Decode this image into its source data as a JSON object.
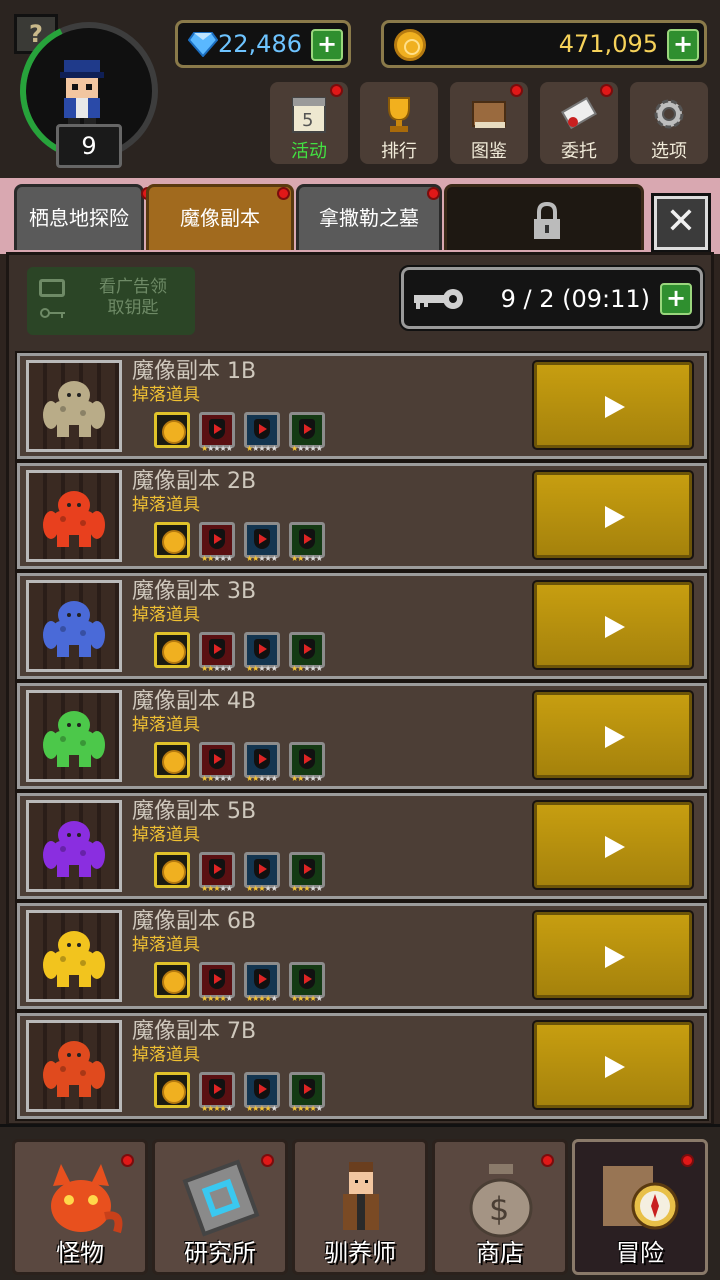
{
  "player": {
    "level": "9",
    "help_glyph": "?"
  },
  "currency": {
    "gems": "22,486",
    "gold": "471,095",
    "plus_glyph": "+"
  },
  "top_menu": [
    {
      "label": "活动",
      "icon": "calendar-icon",
      "active": true,
      "badge": true
    },
    {
      "label": "排行",
      "icon": "trophy-icon",
      "active": false,
      "badge": false
    },
    {
      "label": "图鉴",
      "icon": "book-icon",
      "active": false,
      "badge": true
    },
    {
      "label": "委托",
      "icon": "scroll-icon",
      "active": false,
      "badge": true
    },
    {
      "label": "选项",
      "icon": "gear-icon",
      "active": false,
      "badge": false
    }
  ],
  "tabs": [
    {
      "label": "栖息地探险",
      "badge": true
    },
    {
      "label": "魔像副本",
      "badge": true,
      "active": true
    },
    {
      "label": "拿撒勒之墓",
      "badge": true
    },
    {
      "label": "",
      "locked": true
    }
  ],
  "close_glyph": "✕",
  "ad_button": {
    "line1": "看广告领",
    "line2": "取钥匙"
  },
  "keys": {
    "value": "9 / 2 (09:11)"
  },
  "dungeons": [
    {
      "title": "魔像副本 1B",
      "subtitle": "掉落道具",
      "golem_color": "#b9ac88",
      "stars": [
        1,
        1,
        1
      ]
    },
    {
      "title": "魔像副本 2B",
      "subtitle": "掉落道具",
      "golem_color": "#e8401e",
      "stars": [
        2,
        2,
        2
      ]
    },
    {
      "title": "魔像副本 3B",
      "subtitle": "掉落道具",
      "golem_color": "#4a6ad8",
      "stars": [
        2,
        2,
        2
      ]
    },
    {
      "title": "魔像副本 4B",
      "subtitle": "掉落道具",
      "golem_color": "#4cc84a",
      "stars": [
        2,
        2,
        2
      ]
    },
    {
      "title": "魔像副本 5B",
      "subtitle": "掉落道具",
      "golem_color": "#8a2ee0",
      "stars": [
        3,
        3,
        3
      ]
    },
    {
      "title": "魔像副本 6B",
      "subtitle": "掉落道具",
      "golem_color": "#f2c41e",
      "stars": [
        4,
        4,
        4
      ]
    },
    {
      "title": "魔像副本 7B",
      "subtitle": "掉落道具",
      "golem_color": "#e04a1e",
      "stars": [
        4,
        4,
        4
      ]
    }
  ],
  "bottom_nav": [
    {
      "label": "怪物",
      "icon": "monster-icon",
      "badge": true
    },
    {
      "label": "研究所",
      "icon": "research-icon",
      "badge": true
    },
    {
      "label": "驯养师",
      "icon": "trainer-icon",
      "badge": false
    },
    {
      "label": "商店",
      "icon": "moneybag-icon",
      "badge": true
    },
    {
      "label": "冒险",
      "icon": "compass-icon",
      "badge": true,
      "active": true
    }
  ]
}
